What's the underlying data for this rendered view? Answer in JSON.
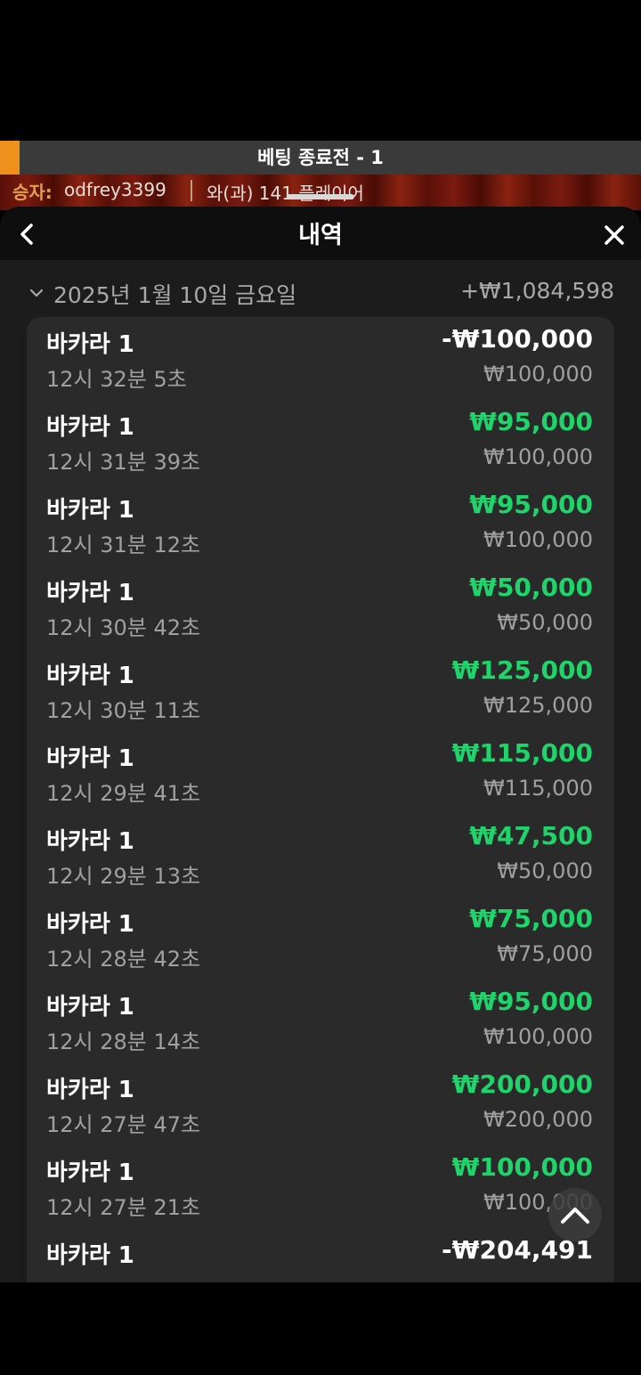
{
  "banner": {
    "title": "베팅 종료전 - 1",
    "accent_color": "#f0901c"
  },
  "winner": {
    "label": "승자:",
    "name": "odfrey3399",
    "count_text": "와(과) 141 플레이어"
  },
  "sheet": {
    "title": "내역",
    "back_icon": "chevron-left-icon",
    "close_icon": "close-icon"
  },
  "summary": {
    "date": "2025년 1월 10일 금요일",
    "total": "+₩1,084,598"
  },
  "rows": [
    {
      "game": "바카라 1",
      "time": "12시 32분 5초",
      "payout": "-₩100,000",
      "stake": "₩100,000",
      "result": "loss"
    },
    {
      "game": "바카라 1",
      "time": "12시 31분 39초",
      "payout": "₩95,000",
      "stake": "₩100,000",
      "result": "win"
    },
    {
      "game": "바카라 1",
      "time": "12시 31분 12초",
      "payout": "₩95,000",
      "stake": "₩100,000",
      "result": "win"
    },
    {
      "game": "바카라 1",
      "time": "12시 30분 42초",
      "payout": "₩50,000",
      "stake": "₩50,000",
      "result": "win"
    },
    {
      "game": "바카라 1",
      "time": "12시 30분 11초",
      "payout": "₩125,000",
      "stake": "₩125,000",
      "result": "win"
    },
    {
      "game": "바카라 1",
      "time": "12시 29분 41초",
      "payout": "₩115,000",
      "stake": "₩115,000",
      "result": "win"
    },
    {
      "game": "바카라 1",
      "time": "12시 29분 13초",
      "payout": "₩47,500",
      "stake": "₩50,000",
      "result": "win"
    },
    {
      "game": "바카라 1",
      "time": "12시 28분 42초",
      "payout": "₩75,000",
      "stake": "₩75,000",
      "result": "win"
    },
    {
      "game": "바카라 1",
      "time": "12시 28분 14초",
      "payout": "₩95,000",
      "stake": "₩100,000",
      "result": "win"
    },
    {
      "game": "바카라 1",
      "time": "12시 27분 47초",
      "payout": "₩200,000",
      "stake": "₩200,000",
      "result": "win"
    },
    {
      "game": "바카라 1",
      "time": "12시 27분 21초",
      "payout": "₩100,000",
      "stake": "₩100,000",
      "result": "win"
    },
    {
      "game": "바카라 1",
      "time": "",
      "payout": "-₩204,491",
      "stake": "",
      "result": "loss"
    }
  ],
  "colors": {
    "win": "#1fd46a",
    "loss": "#ffffff",
    "muted": "#a0a0a0"
  },
  "scroll_top_icon": "chevron-up-icon"
}
